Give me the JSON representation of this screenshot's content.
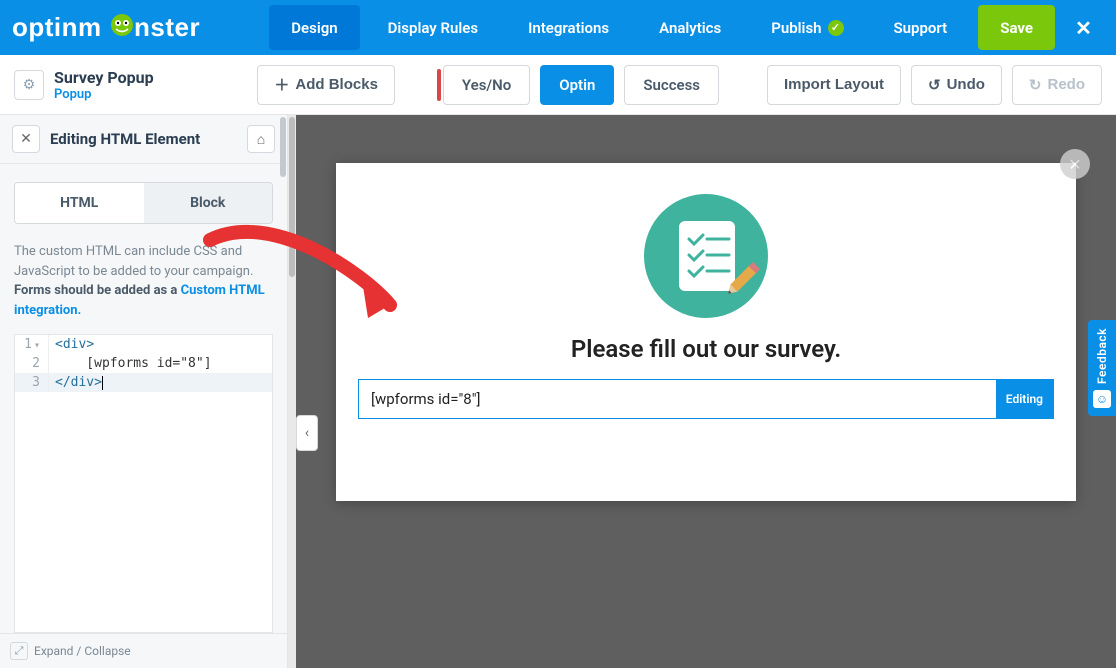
{
  "brand": "optinmonster",
  "topnav": {
    "design": "Design",
    "display_rules": "Display Rules",
    "integrations": "Integrations",
    "analytics": "Analytics",
    "publish": "Publish",
    "support": "Support",
    "save": "Save"
  },
  "campaign": {
    "title": "Survey Popup",
    "type": "Popup"
  },
  "toolbar": {
    "add_blocks": "Add Blocks",
    "yesno": "Yes/No",
    "optin": "Optin",
    "success": "Success",
    "import_layout": "Import Layout",
    "undo": "Undo",
    "redo": "Redo"
  },
  "sidebar": {
    "title": "Editing HTML Element",
    "tabs": {
      "html": "HTML",
      "block": "Block"
    },
    "help_plain": "The custom HTML can include CSS and JavaScript to be added to your campaign. ",
    "help_bold": "Forms should be added as a ",
    "help_link": "Custom HTML integration.",
    "footer": "Expand / Collapse"
  },
  "code": {
    "line1_num": "1",
    "line2_num": "2",
    "line3_num": "3",
    "line1_a": "<",
    "line1_b": "div",
    "line1_c": ">",
    "line2": "    [wpforms id=\"8\"]",
    "line3_a": "</",
    "line3_b": "div",
    "line3_c": ">"
  },
  "popup": {
    "title": "Please fill out our survey.",
    "html_block_text": "[wpforms id=\"8\"]",
    "editing_badge": "Editing"
  },
  "feedback": "Feedback"
}
